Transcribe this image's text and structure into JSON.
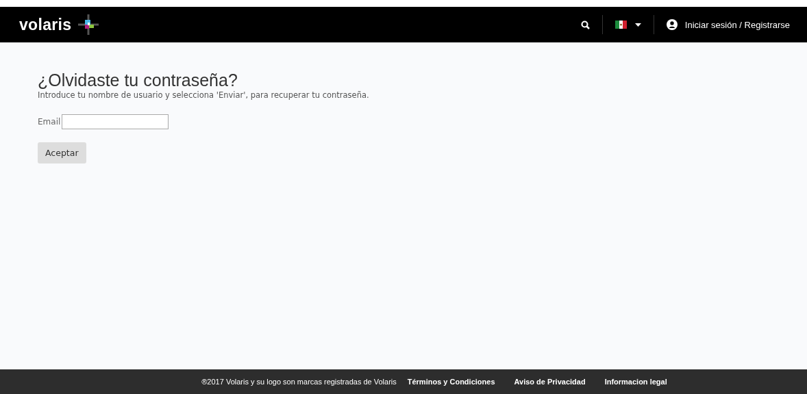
{
  "header": {
    "logo": "volaris",
    "login": "Iniciar sesión / Registrarse"
  },
  "form": {
    "title": "¿Olvidaste tu contraseña?",
    "instructions": "Introduce tu nombre de usuario y selecciona 'Enviar', para recuperar tu contraseña.",
    "email_label": "Email",
    "submit": "Aceptar"
  },
  "footer": {
    "copyright": "®2017 Volaris y su logo son marcas registradas de Volaris",
    "links": [
      "Términos y Condiciones",
      "Aviso de Privacidad",
      "Informacion legal"
    ]
  }
}
